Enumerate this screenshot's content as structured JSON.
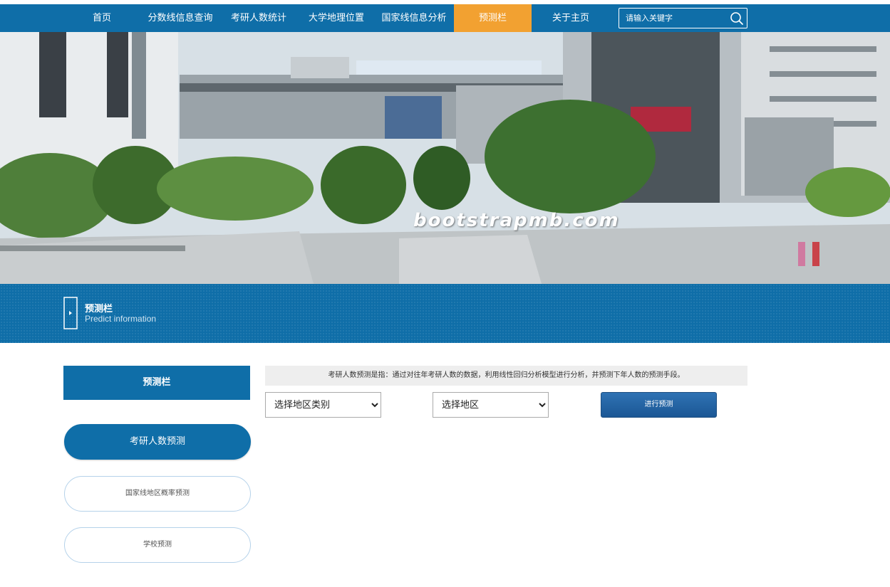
{
  "nav": {
    "items": [
      {
        "label": "首页"
      },
      {
        "label": "分数线信息查询"
      },
      {
        "label": "考研人数统计"
      },
      {
        "label": "大学地理位置"
      },
      {
        "label": "国家线信息分析"
      },
      {
        "label": "预测栏"
      },
      {
        "label": "关于主页"
      }
    ],
    "active_index": 5,
    "search_placeholder": "请输入关键字",
    "active_color": "#f2a131",
    "bar_color": "#0f6ea8"
  },
  "banner": {
    "watermark": "bootstrapmb.com"
  },
  "section": {
    "title": "预测栏",
    "subtitle": "Predict information",
    "icon": "door-icon"
  },
  "sidebar": {
    "heading": "预测栏",
    "items": [
      {
        "label": "考研人数预测",
        "active": true
      },
      {
        "label": "国家线地区概率预测",
        "active": false
      },
      {
        "label": "学校预测",
        "active": false
      }
    ]
  },
  "main": {
    "description": "考研人数预测是指：通过对往年考研人数的数据，利用线性回归分析模型进行分析，并预测下年人数的预测手段。",
    "select_category": {
      "selected": "选择地区类别"
    },
    "select_region": {
      "selected": "选择地区"
    },
    "predict_button": "进行预测"
  }
}
